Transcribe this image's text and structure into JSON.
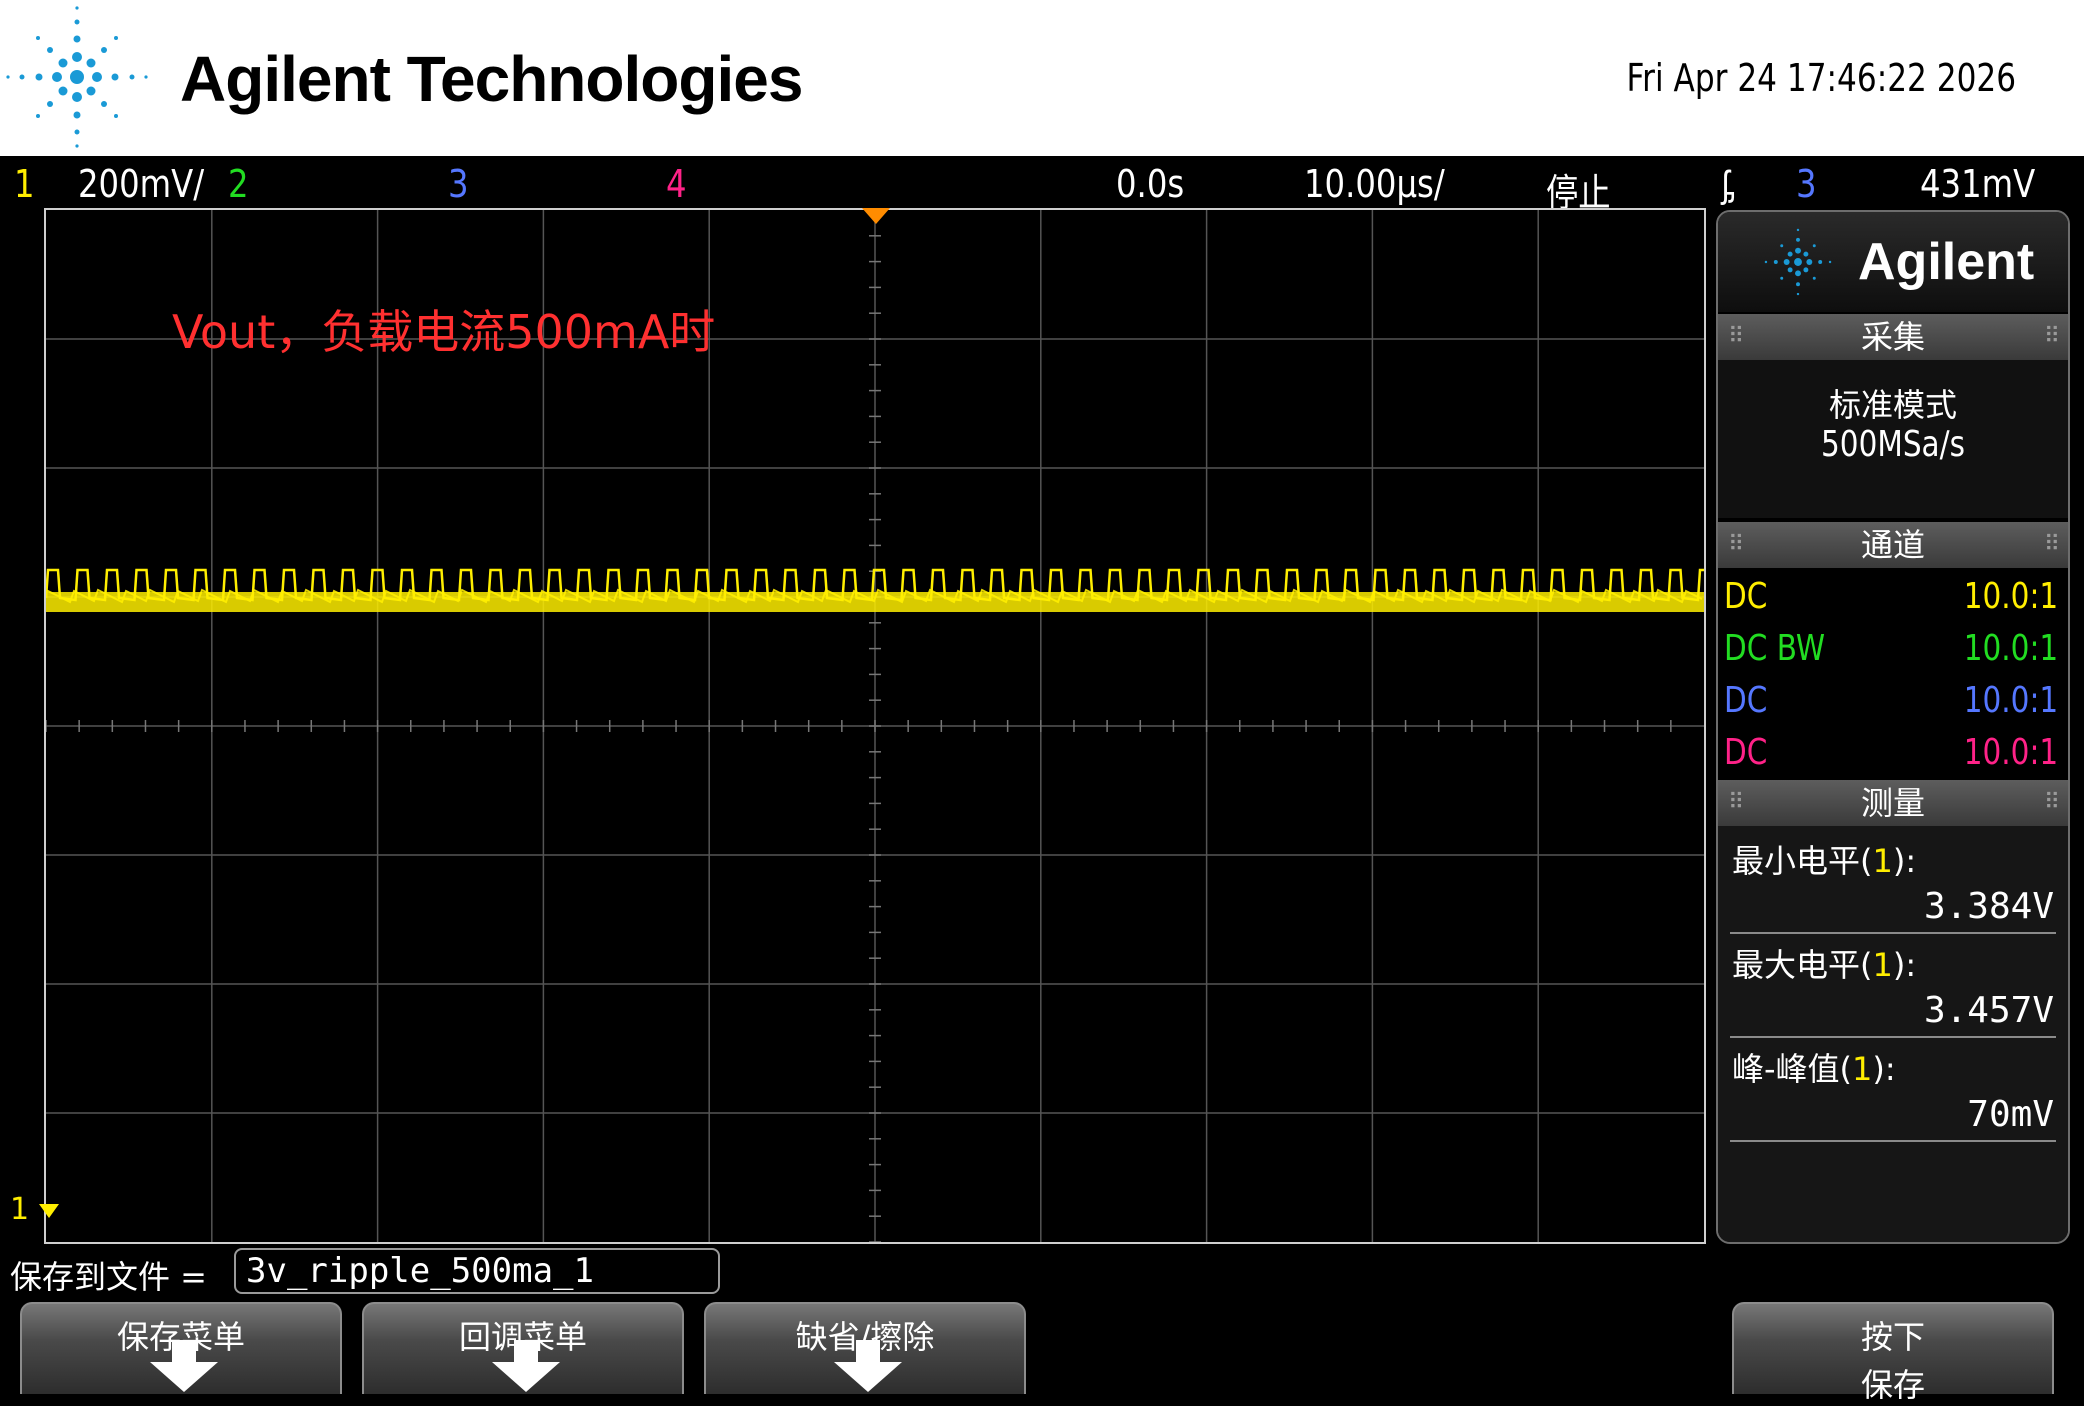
{
  "header": {
    "brand": "Agilent Technologies",
    "datetime": "Fri Apr 24 17:46:22 2026"
  },
  "status": {
    "ch1_num": "1",
    "ch1_scale": "200mV/",
    "ch2_num": "2",
    "ch3_num": "3",
    "ch4_num": "4",
    "delay": "0.0s",
    "timebase": "10.00μs/",
    "run_state": "停止",
    "trigger_symbol": "ᶋ",
    "trigger_source": "3",
    "trigger_level": "431mV"
  },
  "display": {
    "annotation": "Vout，负载电流500mA时",
    "ch1_marker": "1"
  },
  "panel": {
    "brand": "Agilent",
    "acquire": {
      "title": "采集",
      "mode": "标准模式",
      "rate": "500MSa/s"
    },
    "channels": {
      "title": "通道",
      "items": [
        {
          "coupling": "DC",
          "probe": "10.0:1",
          "color": "#ffee00"
        },
        {
          "coupling": "DC BW",
          "probe": "10.0:1",
          "color": "#22dd22"
        },
        {
          "coupling": "DC",
          "probe": "10.0:1",
          "color": "#5577ff"
        },
        {
          "coupling": "DC",
          "probe": "10.0:1",
          "color": "#ff2288"
        }
      ]
    },
    "measure": {
      "title": "测量",
      "items": [
        {
          "label": "最小电平(",
          "src": "1",
          "close": "):",
          "value": "3.384V"
        },
        {
          "label": "最大电平(",
          "src": "1",
          "close": "):",
          "value": "3.457V"
        },
        {
          "label": "峰-峰值(",
          "src": "1",
          "close": "):",
          "value": "70mV"
        }
      ]
    }
  },
  "bottom": {
    "save_label": "保存到文件 =",
    "save_value": "3v_ripple_500ma_1",
    "softkeys": [
      "保存菜单",
      "回调菜单",
      "缺省/擦除"
    ],
    "press_save_1": "按下",
    "press_save_2": "保存"
  },
  "colors": {
    "ch1": "#ffee00",
    "ch2": "#22dd22",
    "ch3": "#5577ff",
    "ch4": "#ff2288",
    "trigger": "#ff8c00",
    "annotation": "#ff3030"
  }
}
